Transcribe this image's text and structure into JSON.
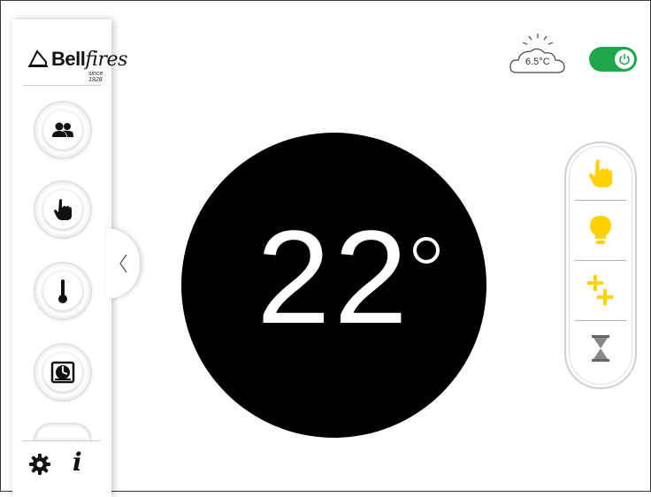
{
  "brand": {
    "name": "Bell",
    "name_italic": "fires",
    "tagline": "since 1928"
  },
  "sidebar": {
    "items": [
      {
        "name": "users-icon"
      },
      {
        "name": "hand-pointer-icon"
      },
      {
        "name": "thermometer-icon"
      },
      {
        "name": "schedule-icon"
      }
    ],
    "info_label": "i"
  },
  "main": {
    "temperature": "22"
  },
  "weather": {
    "temp": "6.5°C",
    "icon": "partly-sunny-cloud-icon"
  },
  "power": {
    "on": true,
    "color": "#1fa54a"
  },
  "modes": {
    "accent": "#ffd200",
    "items": [
      "manual-hand-icon",
      "bulb-icon",
      "plus-plus-icon",
      "hourglass-icon"
    ]
  }
}
